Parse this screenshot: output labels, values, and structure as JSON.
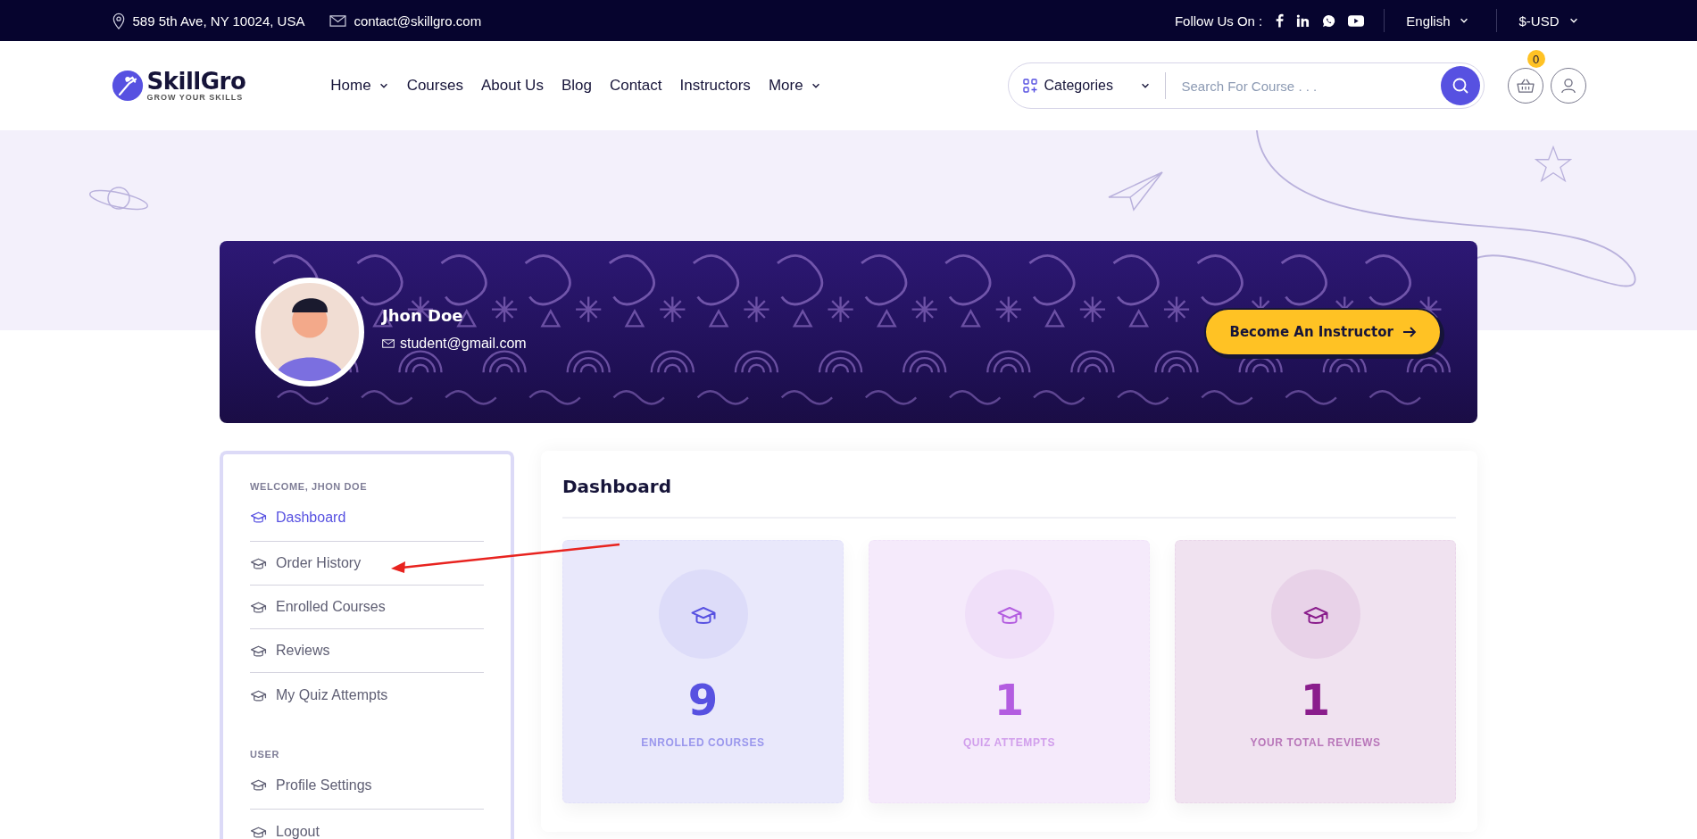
{
  "top_bar": {
    "address": "589 5th Ave, NY 10024, USA",
    "email": "contact@skillgro.com",
    "follow_label": "Follow Us On :",
    "language": "English",
    "currency": "$-USD"
  },
  "header": {
    "logo": {
      "name": "SkillGro",
      "tagline": "GROW YOUR SKILLS"
    },
    "nav": [
      {
        "label": "Home",
        "dropdown": true
      },
      {
        "label": "Courses",
        "dropdown": false
      },
      {
        "label": "About Us",
        "dropdown": false
      },
      {
        "label": "Blog",
        "dropdown": false
      },
      {
        "label": "Contact",
        "dropdown": false
      },
      {
        "label": "Instructors",
        "dropdown": false
      },
      {
        "label": "More",
        "dropdown": true
      }
    ],
    "search": {
      "category": "Categories",
      "placeholder": "Search For Course . . ."
    },
    "cart_count": "0"
  },
  "profile": {
    "name": "Jhon Doe",
    "email": "student@gmail.com",
    "button": "Become An Instructor"
  },
  "sidebar": {
    "sections": [
      {
        "heading": "WELCOME, JHON DOE",
        "items": [
          {
            "label": "Dashboard",
            "selected": true
          },
          {
            "label": "Order History",
            "selected": false
          },
          {
            "label": "Enrolled Courses",
            "selected": false
          },
          {
            "label": "Reviews",
            "selected": false
          },
          {
            "label": "My Quiz Attempts",
            "selected": false
          }
        ]
      },
      {
        "heading": "USER",
        "items": [
          {
            "label": "Profile Settings",
            "selected": false
          },
          {
            "label": "Logout",
            "selected": false
          }
        ]
      }
    ]
  },
  "dashboard": {
    "title": "Dashboard",
    "stats": [
      {
        "value": "9",
        "label": "ENROLLED COURSES",
        "color": "#5751e1"
      },
      {
        "value": "1",
        "label": "QUIZ ATTEMPTS",
        "color": "#b35de0"
      },
      {
        "value": "1",
        "label": "YOUR TOTAL REVIEWS",
        "color": "#8a1d8c"
      }
    ]
  }
}
